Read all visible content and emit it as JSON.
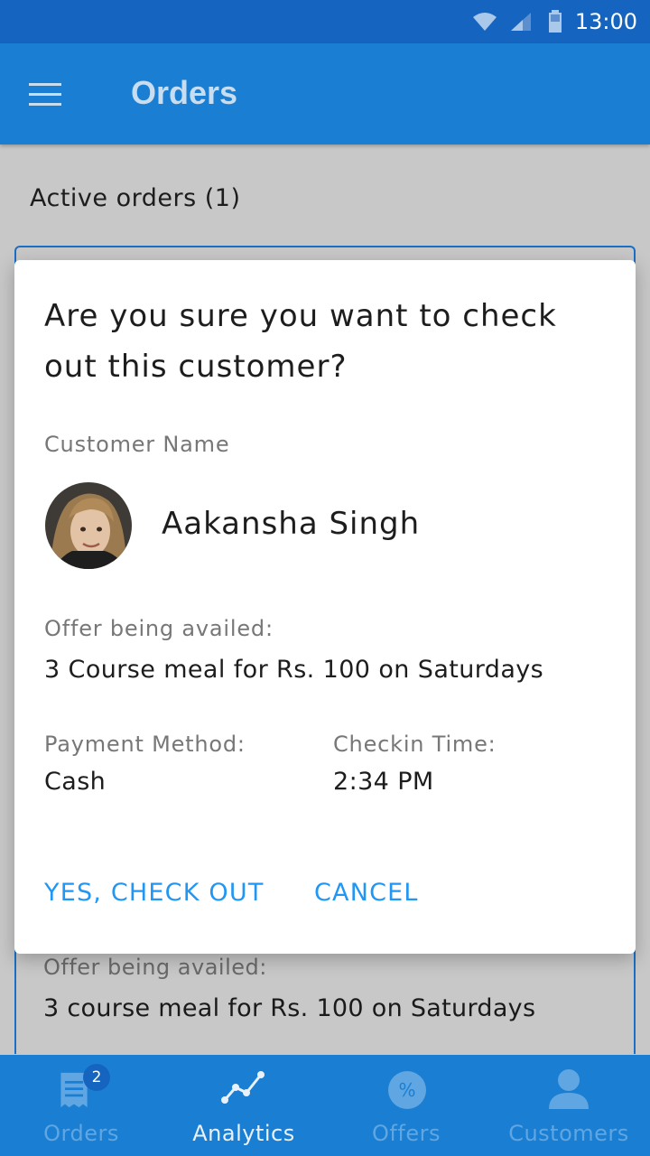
{
  "status_bar": {
    "time": "13:00"
  },
  "app_bar": {
    "title": "Orders"
  },
  "section": {
    "title": "Active orders (1)"
  },
  "background_card": {
    "offer_label": "Offer being availed:",
    "offer_value": "3 course meal for Rs. 100 on Saturdays"
  },
  "dialog": {
    "title": "Are you sure you want to check out this customer?",
    "customer_label": "Customer Name",
    "customer_name": "Aakansha Singh",
    "offer_label": "Offer being availed:",
    "offer_value": "3 Course meal for Rs. 100 on Saturdays",
    "payment_label": "Payment Method:",
    "payment_value": "Cash",
    "checkin_label": "Checkin Time:",
    "checkin_value": "2:34 PM",
    "confirm_label": "YES, CHECK OUT",
    "cancel_label": "CANCEL"
  },
  "bottom_nav": {
    "items": [
      {
        "label": "Orders",
        "icon": "receipt-icon",
        "badge": "2"
      },
      {
        "label": "Analytics",
        "icon": "analytics-icon"
      },
      {
        "label": "Offers",
        "icon": "offer-percent-icon"
      },
      {
        "label": "Customers",
        "icon": "person-icon"
      }
    ],
    "active_index": 1
  },
  "colors": {
    "primary": "#1a7fd3",
    "primary_dark": "#1565c0",
    "accent": "#2196f3",
    "scrim": "#c8c8c8"
  }
}
